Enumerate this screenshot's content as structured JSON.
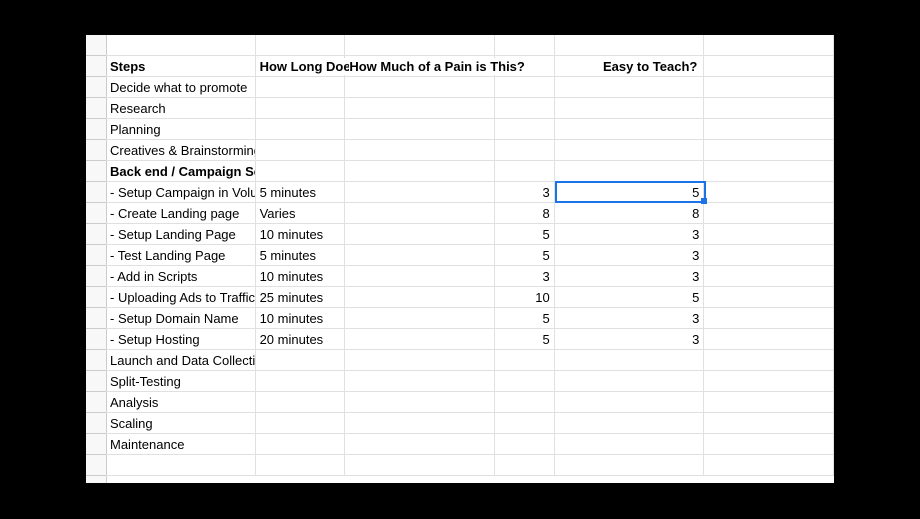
{
  "headers": {
    "steps": "Steps",
    "how_long": "How Long Does the Task Take",
    "pain": "How Much of a Pain is This?",
    "teach": "Easy to Teach?"
  },
  "rows": [
    {
      "step": "Decide what to promote",
      "time": "",
      "pain": "",
      "teach": "",
      "bold": false
    },
    {
      "step": "Research",
      "time": "",
      "pain": "",
      "teach": "",
      "bold": false
    },
    {
      "step": "Planning",
      "time": "",
      "pain": "",
      "teach": "",
      "bold": false
    },
    {
      "step": "Creatives & Brainstorming",
      "time": "",
      "pain": "",
      "teach": "",
      "bold": false
    },
    {
      "step": "Back end / Campaign Setup",
      "time": "",
      "pain": "",
      "teach": "",
      "bold": true
    },
    {
      "step": " - Setup Campaign in Voluum",
      "time": "5 minutes",
      "pain": "3",
      "teach": "5",
      "bold": false
    },
    {
      "step": " - Create Landing page",
      "time": "Varies",
      "pain": "8",
      "teach": "8",
      "bold": false
    },
    {
      "step": " - Setup Landing Page",
      "time": "10 minutes",
      "pain": "5",
      "teach": "3",
      "bold": false
    },
    {
      "step": " - Test Landing Page",
      "time": "5 minutes",
      "pain": "5",
      "teach": "3",
      "bold": false
    },
    {
      "step": " - Add in Scripts",
      "time": "10 minutes",
      "pain": "3",
      "teach": "3",
      "bold": false
    },
    {
      "step": " - Uploading Ads to Traffic Source",
      "time": "25 minutes",
      "pain": "10",
      "teach": "5",
      "bold": false
    },
    {
      "step": " - Setup Domain Name",
      "time": "10 minutes",
      "pain": "5",
      "teach": "3",
      "bold": false
    },
    {
      "step": " - Setup Hosting",
      "time": "20 minutes",
      "pain": "5",
      "teach": "3",
      "bold": false
    },
    {
      "step": "Launch and Data Collection",
      "time": "",
      "pain": "",
      "teach": "",
      "bold": false
    },
    {
      "step": "Split-Testing",
      "time": "",
      "pain": "",
      "teach": "",
      "bold": false
    },
    {
      "step": "Analysis",
      "time": "",
      "pain": "",
      "teach": "",
      "bold": false
    },
    {
      "step": "Scaling",
      "time": "",
      "pain": "",
      "teach": "",
      "bold": false
    },
    {
      "step": "Maintenance",
      "time": "",
      "pain": "",
      "teach": "",
      "bold": false
    }
  ],
  "selected": {
    "row_index": 5,
    "col": "E"
  }
}
